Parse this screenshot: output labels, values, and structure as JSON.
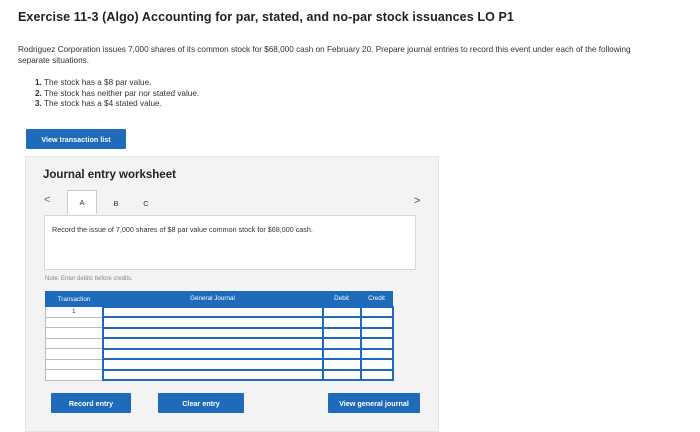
{
  "exercise": {
    "title": "Exercise 11-3 (Algo) Accounting for par, stated, and no-par stock issuances LO P1",
    "intro": "Rodriguez Corporation issues 7,000 shares of its common stock for $68,000 cash on February 20. Prepare journal entries to record this event under each of the following separate situations.",
    "requirements": [
      {
        "num": "1.",
        "text": "The stock has a $8 par value."
      },
      {
        "num": "2.",
        "text": "The stock has neither par nor stated value."
      },
      {
        "num": "3.",
        "text": "The stock has a $4 stated value."
      }
    ]
  },
  "view_transaction_label": "View transaction list",
  "worksheet": {
    "title": "Journal entry worksheet",
    "nav_prev": "<",
    "nav_next": ">",
    "tabs": [
      "A",
      "B",
      "C"
    ],
    "active_tab": "A",
    "question": "Record the issue of 7,000 shares of $8 par value common stock for $68,000 cash.",
    "note": "Note: Enter debits before credits.",
    "table": {
      "headers": [
        "Transaction",
        "General Journal",
        "Debit",
        "Credit"
      ],
      "rows": [
        {
          "transaction": "1"
        },
        {
          "transaction": ""
        },
        {
          "transaction": ""
        },
        {
          "transaction": ""
        },
        {
          "transaction": ""
        },
        {
          "transaction": ""
        },
        {
          "transaction": ""
        }
      ]
    },
    "buttons": {
      "record": "Record entry",
      "clear": "Clear entry",
      "view_general": "View general journal"
    }
  },
  "colors": {
    "accent": "#1e6bbb",
    "panel_bg": "#f3f3f3"
  }
}
